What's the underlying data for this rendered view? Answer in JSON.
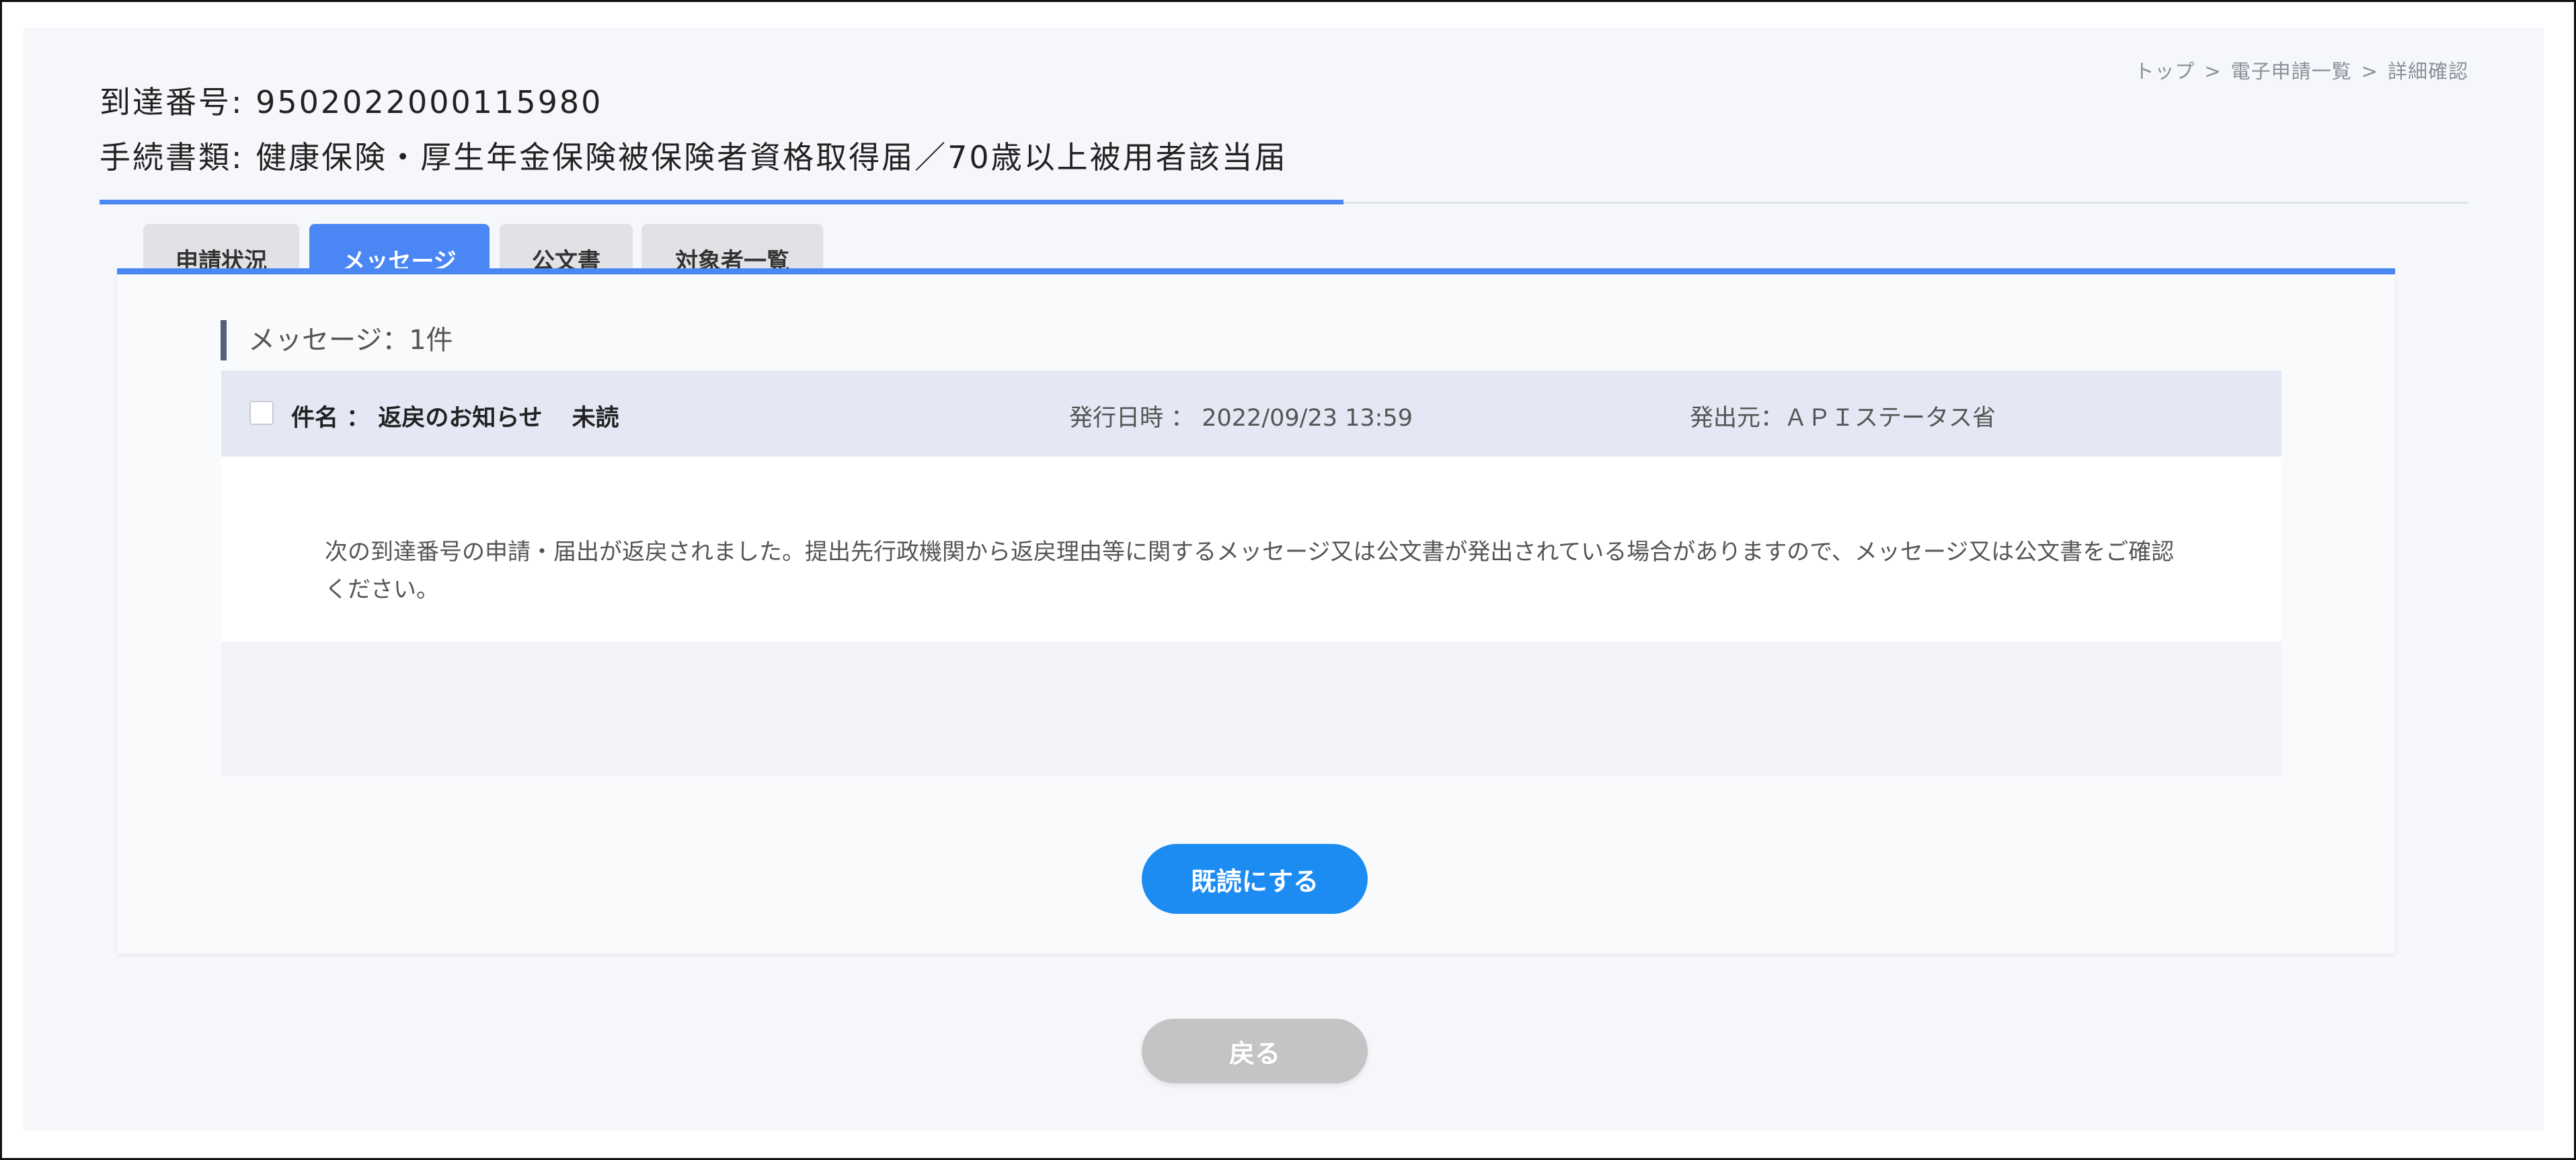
{
  "breadcrumb": {
    "items": [
      "トップ",
      "電子申請一覧",
      "詳細確認"
    ],
    "separator": ">"
  },
  "header": {
    "arrival_label": "到達番号: 9502022000115980",
    "procedure_label": "手続書類: 健康保険・厚生年金保険被保険者資格取得届／70歳以上被用者該当届"
  },
  "tabs": [
    {
      "label": "申請状況",
      "active": false
    },
    {
      "label": "メッセージ",
      "active": true
    },
    {
      "label": "公文書",
      "active": false
    },
    {
      "label": "対象者一覧",
      "active": false
    }
  ],
  "messages": {
    "count_label": "メッセージ：1件",
    "items": [
      {
        "subject_label": "件名 ： 返戻のお知らせ",
        "status": "未読",
        "date_label": "発行日時 ： 2022/09/23 13:59",
        "sender_label": "発出元：ＡＰＩステータス省",
        "body": "次の到達番号の申請・届出が返戻されました。提出先行政機関から返戻理由等に関するメッセージ又は公文書が発出されている場合がありますので、メッセージ又は公文書をご確認ください。"
      }
    ]
  },
  "buttons": {
    "mark_read": "既読にする",
    "back": "戻る"
  },
  "colors": {
    "accent": "#4a87f5",
    "primary_button": "#1c8cf2",
    "disabled_button": "#c4c4c4",
    "message_header_bg": "#e4e7f4"
  }
}
